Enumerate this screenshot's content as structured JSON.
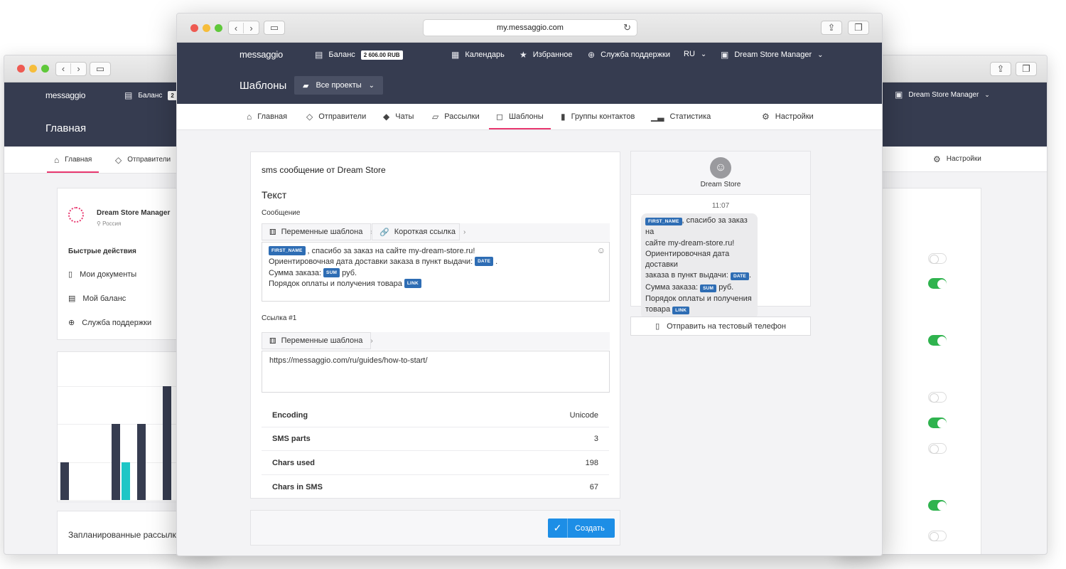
{
  "brand": {
    "logo": "messaggio",
    "accent": "#e8376f",
    "dark": "#363c50",
    "primary": "#1d8ee6"
  },
  "back_left": {
    "topbar": {
      "balance_label": "Баланс",
      "balance_value": "2"
    },
    "page_title": "Главная",
    "nav": [
      {
        "label": "Главная",
        "icon": "home-icon"
      },
      {
        "label": "Отправители",
        "icon": "tag-icon"
      }
    ],
    "profile": {
      "name": "Dream Store Manager",
      "location": "Россия"
    },
    "quick_actions": {
      "title": "Быстрые действия",
      "items": [
        {
          "label": "Мои документы",
          "icon": "document-icon"
        },
        {
          "label": "Мой баланс",
          "icon": "wallet-icon"
        },
        {
          "label": "Служба поддержки",
          "icon": "lifebuoy-icon"
        }
      ]
    },
    "chart_data": {
      "type": "bar",
      "series": [
        {
          "values": [
            0.33,
            0,
            0.67,
            0.67,
            1.0
          ]
        },
        {
          "values": [
            0,
            0,
            0.33,
            0,
            0
          ]
        }
      ],
      "colors": [
        "#363c50",
        "#1ec6c6"
      ],
      "grid": true
    },
    "scheduled_title": "Запланированные рассылки"
  },
  "back_right": {
    "user": "Dream Store Manager",
    "settings_label": "Настройки",
    "toggles": [
      false,
      true,
      true,
      false,
      true,
      false,
      true,
      false
    ]
  },
  "front": {
    "url": "my.messaggio.com",
    "topbar": {
      "balance_label": "Баланс",
      "balance_value": "2 606.00 RUB",
      "calendar": "Календарь",
      "favorites": "Избранное",
      "support": "Служба поддержки",
      "lang": "RU",
      "user": "Dream Store Manager"
    },
    "page_title": "Шаблоны",
    "projects_label": "Все проекты",
    "nav": [
      {
        "label": "Главная",
        "icon": "home-icon"
      },
      {
        "label": "Отправители",
        "icon": "tag-icon"
      },
      {
        "label": "Чаты",
        "icon": "chat-icon"
      },
      {
        "label": "Рассылки",
        "icon": "mailing-icon"
      },
      {
        "label": "Шаблоны",
        "icon": "template-icon",
        "active": true
      },
      {
        "label": "Группы контактов",
        "icon": "contacts-icon"
      },
      {
        "label": "Статистика",
        "icon": "stats-icon"
      },
      {
        "label": "Настройки",
        "icon": "gear-icon"
      }
    ],
    "editor": {
      "template_name": "sms сообщение от Dream Store",
      "section_title": "Текст",
      "message_label": "Сообщение",
      "variables_btn": "Переменные шаблона",
      "short_link_btn": "Короткая ссылка",
      "message_lines": [
        {
          "tag": "FIRST_NAME",
          "text": ", спасибо за заказ на сайте my-dream-store.ru!"
        },
        {
          "text": "Ориентировочная дата доставки заказа в пункт выдачи:",
          "tag_after": "DATE",
          "tail": "."
        },
        {
          "text": "Сумма заказа:",
          "tag_after": "SUM",
          "tail": "руб."
        },
        {
          "text": "Порядок оплаты и получения товара",
          "tag_after": "LINK"
        }
      ],
      "link_label": "Ссылка #1",
      "link_variables_btn": "Переменные шаблона",
      "link_value": "https://messaggio.com/ru/guides/how-to-start/",
      "stats": [
        {
          "k": "Encoding",
          "v": "Unicode"
        },
        {
          "k": "SMS parts",
          "v": "3"
        },
        {
          "k": "Chars used",
          "v": "198"
        },
        {
          "k": "Chars in SMS",
          "v": "67"
        }
      ],
      "create_btn": "Создать"
    },
    "preview": {
      "sender": "Dream Store",
      "time": "11:07",
      "send_test_btn": "Отправить на тестовый телефон",
      "bubble": {
        "tag1": "FIRST_NAME",
        "l1": ", спасибо за заказ на",
        "l2": "сайте my-dream-store.ru!",
        "l3": "Ориентировочная дата доставки",
        "l4": "заказа в пункт выдачи:",
        "tag2": "DATE",
        "l5": "Сумма заказа:",
        "tag3": "SUM",
        "l5b": "руб.",
        "l6": "Порядок оплаты и получения",
        "l7": "товара",
        "tag4": "LINK"
      }
    }
  }
}
